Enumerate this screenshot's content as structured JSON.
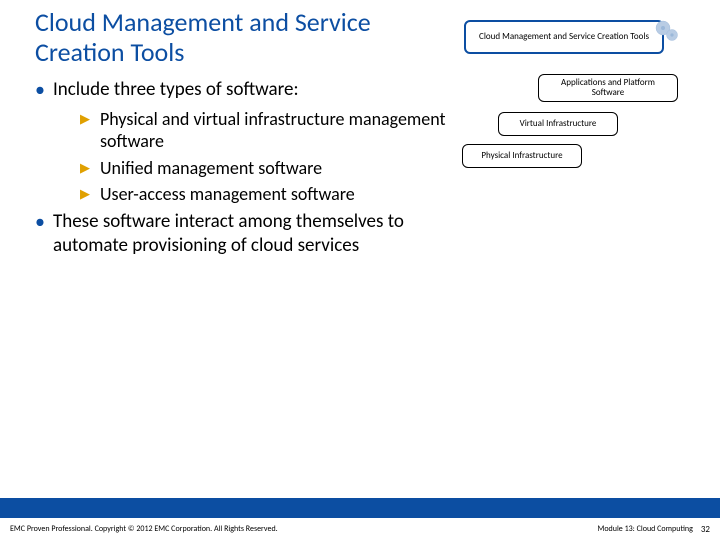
{
  "title": "Cloud Management and Service Creation Tools",
  "bullets": {
    "l1a": "Include three types of software:",
    "l2a": "Physical and virtual infrastructure management software",
    "l2b": "Unified management software",
    "l2c": "User-access management software",
    "l1b": "These software interact among themselves to automate provisioning of cloud services"
  },
  "diagram": {
    "top": "Cloud Management and Service Creation Tools",
    "apps": "Applications and Platform Software",
    "virt": "Virtual Infrastructure",
    "phys": "Physical Infrastructure"
  },
  "footer": {
    "left": "EMC Proven Professional. Copyright © 2012 EMC Corporation. All Rights Reserved.",
    "module": "Module 13: Cloud Computing",
    "page": "32"
  }
}
